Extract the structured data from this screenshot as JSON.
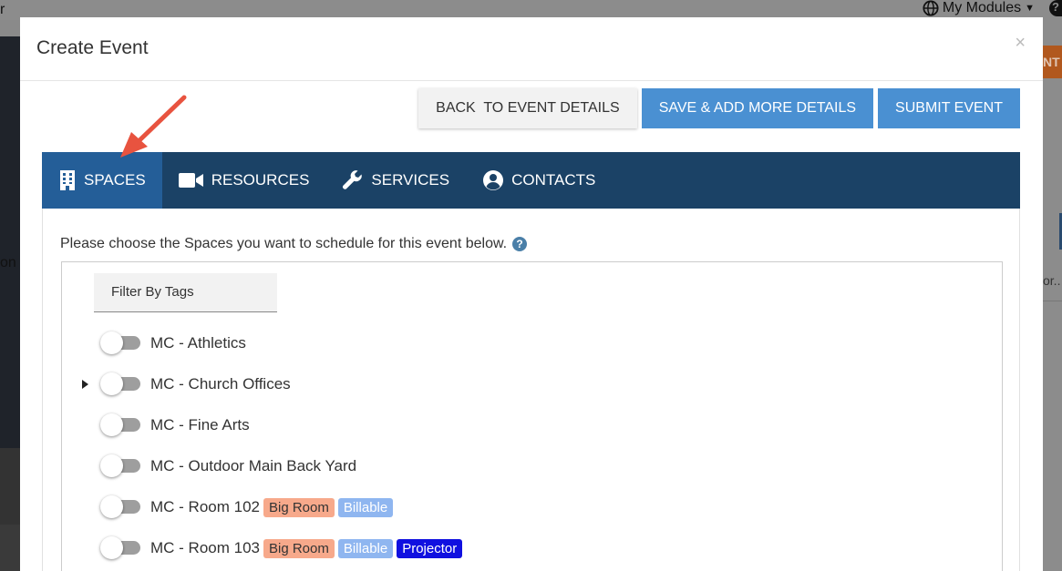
{
  "background": {
    "top_left_char": "r",
    "modules_label": "My Modules",
    "left_text": "on",
    "right_orange_text": "NT",
    "right_text": "or..",
    "help_char": "?"
  },
  "modal": {
    "title": "Create Event",
    "close_label": "×"
  },
  "actions": {
    "back_label": "BACK  TO EVENT DETAILS",
    "save_label": "SAVE & ADD MORE DETAILS",
    "submit_label": "SUBMIT EVENT"
  },
  "tabs": [
    {
      "label": "SPACES",
      "icon": "building-icon",
      "active": true
    },
    {
      "label": "RESOURCES",
      "icon": "video-camera-icon",
      "active": false
    },
    {
      "label": "SERVICES",
      "icon": "wrench-icon",
      "active": false
    },
    {
      "label": "CONTACTS",
      "icon": "user-circle-icon",
      "active": false
    }
  ],
  "content": {
    "instruction": "Please choose the Spaces you want to schedule for this event below.",
    "help_icon": "?",
    "filter_label": "Filter By Tags"
  },
  "spaces": [
    {
      "name": "MC - Athletics",
      "expandable": false,
      "tags": []
    },
    {
      "name": "MC - Church Offices",
      "expandable": true,
      "tags": []
    },
    {
      "name": "MC - Fine Arts",
      "expandable": false,
      "tags": []
    },
    {
      "name": "MC - Outdoor Main Back Yard",
      "expandable": false,
      "tags": []
    },
    {
      "name": "MC - Room 102",
      "expandable": false,
      "tags": [
        "Big Room",
        "Billable"
      ]
    },
    {
      "name": "MC - Room 103",
      "expandable": false,
      "tags": [
        "Big Room",
        "Billable",
        "Projector"
      ]
    }
  ],
  "colors": {
    "tab_bar": "#1b4266",
    "tab_active": "#245e98",
    "primary_button": "#4a90d2",
    "tag_big_room": "#f7a98b",
    "tag_billable": "#8fb6f0",
    "tag_projector": "#1010e0",
    "annotation_arrow": "#e8533f"
  }
}
